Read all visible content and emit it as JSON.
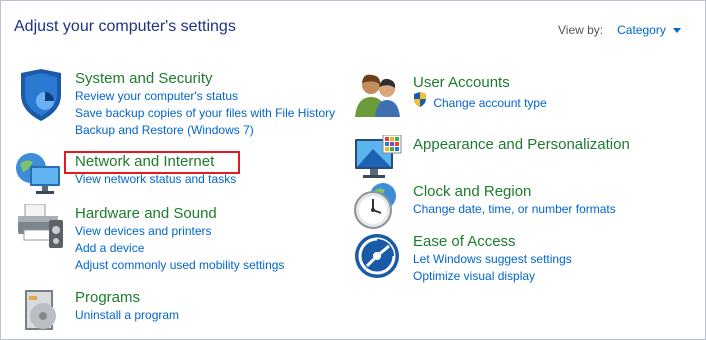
{
  "header": {
    "title": "Adjust your computer's settings",
    "view_by_label": "View by:",
    "view_by_value": "Category"
  },
  "left": [
    {
      "title": "System and Security",
      "icon": "shield-icon",
      "links": [
        "Review your computer's status",
        "Save backup copies of your files with File History",
        "Backup and Restore (Windows 7)"
      ]
    },
    {
      "title": "Network and Internet",
      "icon": "globe-network-icon",
      "links": [
        "View network status and tasks"
      ]
    },
    {
      "title": "Hardware and Sound",
      "icon": "printer-icon",
      "links": [
        "View devices and printers",
        "Add a device",
        "Adjust commonly used mobility settings"
      ]
    },
    {
      "title": "Programs",
      "icon": "programs-icon",
      "links": [
        "Uninstall a program"
      ]
    }
  ],
  "right": [
    {
      "title": "User Accounts",
      "icon": "users-icon",
      "links": [
        "Change account type"
      ]
    },
    {
      "title": "Appearance and Personalization",
      "icon": "monitor-icon",
      "links": []
    },
    {
      "title": "Clock and Region",
      "icon": "clock-globe-icon",
      "links": [
        "Change date, time, or number formats"
      ]
    },
    {
      "title": "Ease of Access",
      "icon": "ease-of-access-icon",
      "links": [
        "Let Windows suggest settings",
        "Optimize visual display"
      ]
    }
  ],
  "colors": {
    "title_green": "#1e7c2d",
    "link_blue": "#0066cc",
    "header_blue": "#1e3287",
    "highlight_red": "#e01b22"
  }
}
